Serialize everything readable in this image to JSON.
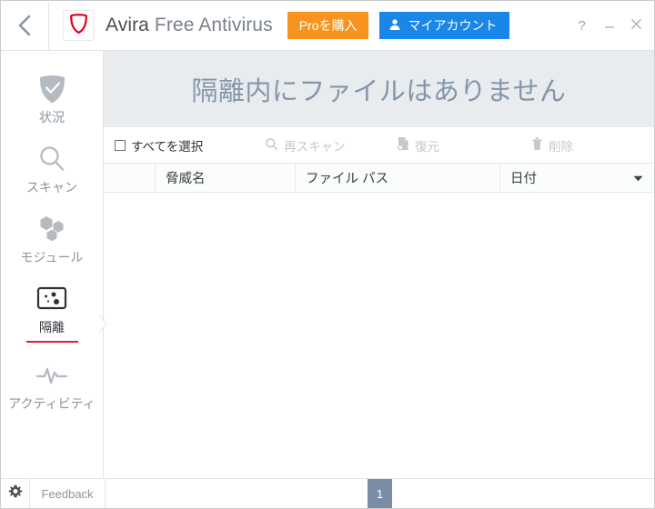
{
  "window": {
    "back_icon": "chevron-left-icon",
    "logo_icon": "avira-shield-logo",
    "brand_primary": "Avira",
    "brand_secondary": "Free Antivirus",
    "pro_button": "Proを購入",
    "account_button": "マイアカウント",
    "account_icon": "user-icon",
    "help_button": "?",
    "minimize_button": "–",
    "close_button": "✕",
    "accent_orange": "#f7941e",
    "accent_blue": "#1a87e8",
    "accent_red": "#e31e24"
  },
  "sidebar": {
    "items": [
      {
        "label": "状況",
        "icon": "shield-check-icon",
        "active": false
      },
      {
        "label": "スキャン",
        "icon": "magnifier-icon",
        "active": false
      },
      {
        "label": "モジュール",
        "icon": "hexagon-cluster-icon",
        "active": false
      },
      {
        "label": "隔離",
        "icon": "quarantine-box-icon",
        "active": true
      },
      {
        "label": "アクティビティ",
        "icon": "pulse-line-icon",
        "active": false
      }
    ]
  },
  "main": {
    "header_title": "隔離内にファイルはありません",
    "toolbar": [
      {
        "label": "すべてを選択",
        "icon": "checkbox-icon",
        "enabled": true
      },
      {
        "label": "再スキャン",
        "icon": "magnifier-icon",
        "enabled": false
      },
      {
        "label": "復元",
        "icon": "restore-file-icon",
        "enabled": false
      },
      {
        "label": "削除",
        "icon": "trash-icon",
        "enabled": false
      }
    ],
    "table": {
      "columns": [
        "脅威名",
        "ファイル パス",
        "日付"
      ],
      "sort_caret_icon": "chevron-down-icon",
      "rows": []
    }
  },
  "statusbar": {
    "gear_icon": "gear-icon",
    "feedback_label": "Feedback",
    "page_number": "1",
    "page_badge_color": "#7b8ca6"
  }
}
